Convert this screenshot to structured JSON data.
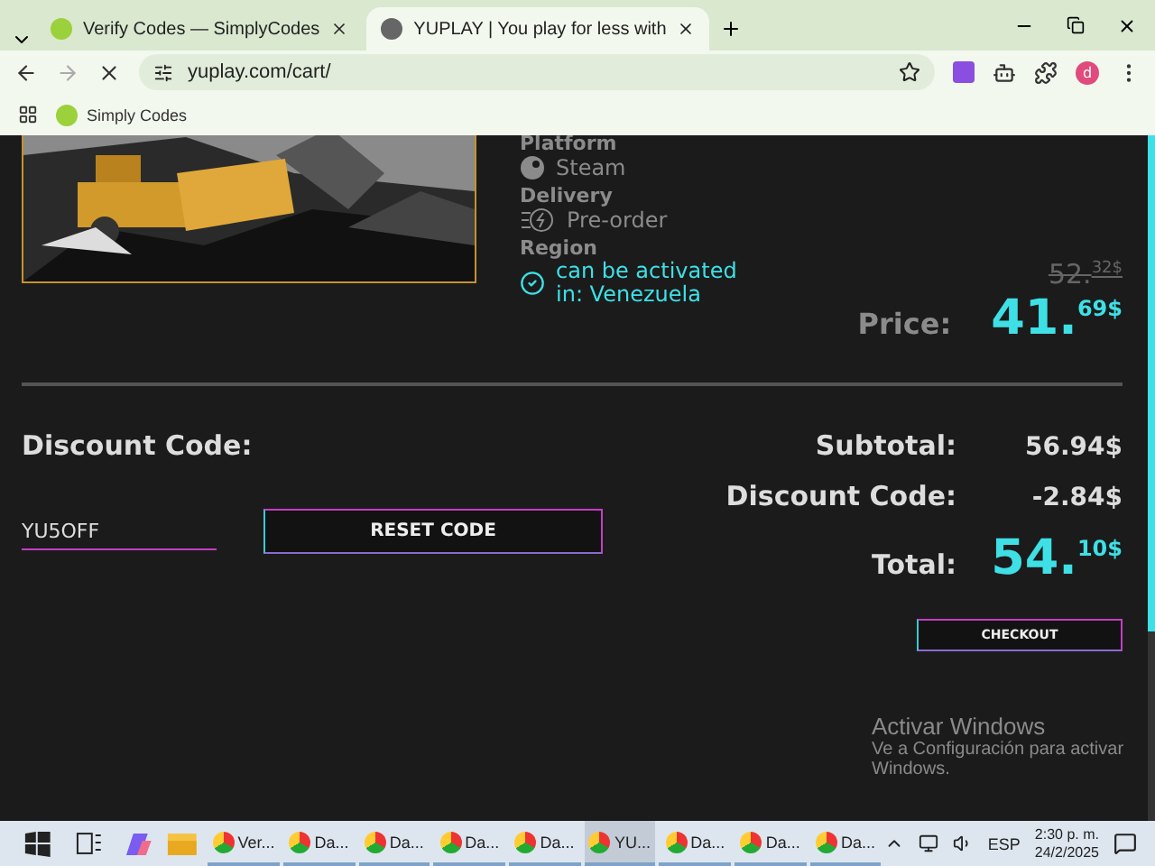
{
  "browser": {
    "tabs": [
      {
        "title": "Verify Codes — SimplyCodes",
        "selected": false
      },
      {
        "title": "YUPLAY | You play for less with",
        "selected": true
      }
    ],
    "address": "yuplay.com/cart/",
    "bookmarks": [
      {
        "label": "Simply Codes"
      }
    ],
    "profile_initial": "d"
  },
  "product": {
    "details": [
      {
        "heading": "Platform",
        "value": "Steam",
        "kind": "platform"
      },
      {
        "heading": "Delivery",
        "value": "Pre-order",
        "kind": "delivery"
      },
      {
        "heading": "Region",
        "value": "can be activated in: Venezuela",
        "kind": "region"
      }
    ],
    "old_price_main": "52.",
    "old_price_cents": "32$",
    "price_label": "Price:",
    "price_main": "41.",
    "price_cents": "69$"
  },
  "discount": {
    "heading": "Discount Code:",
    "code": "YU5OFF",
    "reset_button": "RESET CODE"
  },
  "summary": [
    {
      "label": "Subtotal:",
      "value": "56.94$",
      "kind": "plain"
    },
    {
      "label": "Discount Code:",
      "value": "-2.84$",
      "kind": "plain"
    },
    {
      "label": "Total:",
      "value": "54.",
      "cents": "10$",
      "kind": "total"
    }
  ],
  "checkout_button": "CHECKOUT",
  "watermark": {
    "title": "Activar Windows",
    "text": "Ve a Configuración para activar Windows."
  },
  "taskbar": {
    "apps": [
      {
        "label": "Ver...",
        "selected": false
      },
      {
        "label": "Da...",
        "selected": false
      },
      {
        "label": "Da...",
        "selected": false
      },
      {
        "label": "Da...",
        "selected": false
      },
      {
        "label": "Da...",
        "selected": false
      },
      {
        "label": "YU...",
        "selected": true
      },
      {
        "label": "Da...",
        "selected": false
      },
      {
        "label": "Da...",
        "selected": false
      },
      {
        "label": "Da...",
        "selected": false
      }
    ],
    "language": "ESP",
    "time": "2:30 p. m.",
    "date": "24/2/2025"
  }
}
